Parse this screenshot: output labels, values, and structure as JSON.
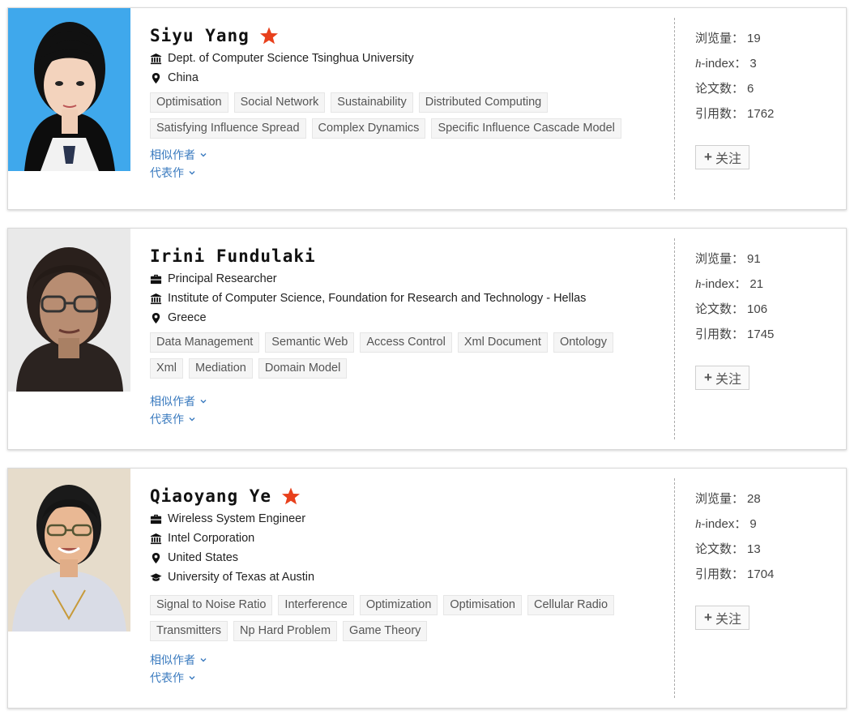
{
  "labels": {
    "similar_authors": "相似作者",
    "representative_works": "代表作",
    "views": "浏览量：",
    "h_prefix": "h",
    "h_suffix": "-index：",
    "papers": "论文数：",
    "citations": "引用数：",
    "follow": "关注",
    "follow_plus": "+"
  },
  "colors": {
    "star": "#e8401c",
    "link": "#3b7bbf",
    "tag_bg": "#f5f5f5"
  },
  "authors": [
    {
      "name": "Siyu Yang",
      "starred": true,
      "meta": [
        {
          "icon": "institution-icon",
          "text": "Dept. of Computer Science Tsinghua University"
        },
        {
          "icon": "location-pin-icon",
          "text": "China"
        }
      ],
      "tags": [
        "Optimisation",
        "Social Network",
        "Sustainability",
        "Distributed Computing",
        "Satisfying Influence Spread",
        "Complex Dynamics",
        "Specific Influence Cascade Model"
      ],
      "stats": {
        "views": "19",
        "h_index": "3",
        "papers": "6",
        "citations": "1762"
      }
    },
    {
      "name": "Irini Fundulaki",
      "starred": false,
      "meta": [
        {
          "icon": "briefcase-icon",
          "text": "Principal Researcher"
        },
        {
          "icon": "institution-icon",
          "text": "Institute of Computer Science, Foundation for Research and Technology - Hellas"
        },
        {
          "icon": "location-pin-icon",
          "text": "Greece"
        }
      ],
      "tags": [
        "Data Management",
        "Semantic Web",
        "Access Control",
        "Xml Document",
        "Ontology",
        "Xml",
        "Mediation",
        "Domain Model"
      ],
      "stats": {
        "views": "91",
        "h_index": "21",
        "papers": "106",
        "citations": "1745"
      }
    },
    {
      "name": "Qiaoyang Ye",
      "starred": true,
      "meta": [
        {
          "icon": "briefcase-icon",
          "text": "Wireless System Engineer"
        },
        {
          "icon": "institution-icon",
          "text": "Intel Corporation"
        },
        {
          "icon": "location-pin-icon",
          "text": "United States"
        },
        {
          "icon": "graduation-cap-icon",
          "text": "University of Texas at Austin"
        }
      ],
      "tags": [
        "Signal to Noise Ratio",
        "Interference",
        "Optimization",
        "Optimisation",
        "Cellular Radio",
        "Transmitters",
        "Np Hard Problem",
        "Game Theory"
      ],
      "stats": {
        "views": "28",
        "h_index": "9",
        "papers": "13",
        "citations": "1704"
      }
    }
  ]
}
